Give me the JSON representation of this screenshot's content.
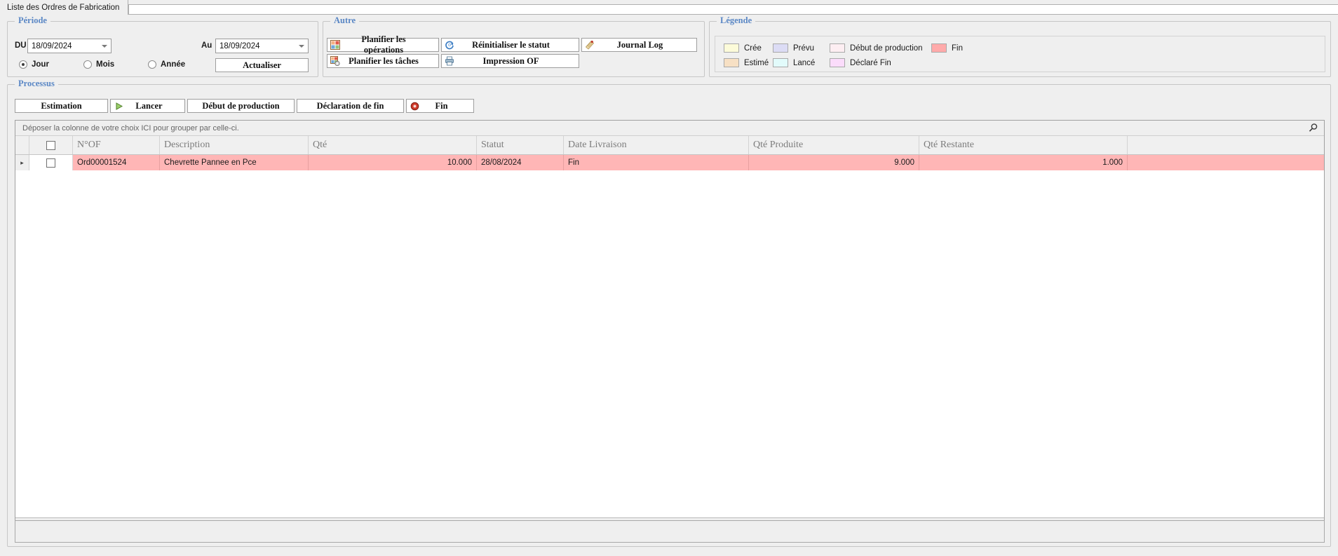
{
  "tab": {
    "label": "Liste des Ordres de Fabrication"
  },
  "periode": {
    "title": "Période",
    "du_label": "DU",
    "du_value": "18/09/2024",
    "au_label": "Au",
    "au_value": "18/09/2024",
    "radios": [
      {
        "label": "Jour",
        "checked": true
      },
      {
        "label": "Mois",
        "checked": false
      },
      {
        "label": "Année",
        "checked": false
      }
    ],
    "refresh_label": "Actualiser"
  },
  "autre": {
    "title": "Autre",
    "buttons": [
      {
        "label": "Planifier les opérations",
        "icon": "grid-color-icon"
      },
      {
        "label": "Planifier les tâches",
        "icon": "grid-gear-icon"
      },
      {
        "label": "Réinitialiser le statut",
        "icon": "refresh-icon"
      },
      {
        "label": "Impression OF",
        "icon": "printer-icon"
      },
      {
        "label": "Journal Log",
        "icon": "notebook-icon"
      }
    ]
  },
  "legende": {
    "title": "Légende",
    "items": [
      {
        "label": "Crée",
        "color": "#fcfbd9"
      },
      {
        "label": "Prévu",
        "color": "#dcdcf5"
      },
      {
        "label": "Début de production",
        "color": "#fdeef2"
      },
      {
        "label": "Fin",
        "color": "#ffaaaa"
      },
      {
        "label": "Estimé",
        "color": "#f7e0c4"
      },
      {
        "label": "Lancé",
        "color": "#e2fbfb"
      },
      {
        "label": "Déclaré Fin",
        "color": "#fbdcfb"
      }
    ]
  },
  "processus": {
    "title": "Processus",
    "buttons": [
      {
        "label": "Estimation",
        "icon": "none"
      },
      {
        "label": "Lancer",
        "icon": "play-green-icon"
      },
      {
        "label": "Début de production",
        "icon": "none"
      },
      {
        "label": "Déclaration de fin",
        "icon": "none"
      },
      {
        "label": "Fin",
        "icon": "stop-red-icon"
      }
    ]
  },
  "grid": {
    "group_hint": "Déposer la colonne de votre choix ICI pour grouper par celle-ci.",
    "search_icon": "search-icon",
    "columns": [
      "N°OF",
      "Description",
      "Qté",
      "Statut",
      "Date Livraison",
      "Qté Produite",
      "Qté Restante"
    ],
    "rows": [
      {
        "row_color": "#ffb6b6",
        "indicator": "▸",
        "selected": false,
        "nof": "Ord00001524",
        "description": "Chevrette Pannee en Pce",
        "qte": "10.000",
        "statut": "28/08/2024",
        "date_livraison": "Fin",
        "qte_produite": "9.000",
        "qte_restante": "1.000"
      }
    ]
  },
  "colors": {
    "accent": "#5a87c5",
    "window": "#efefef",
    "grid_header": "#f0f0f0",
    "row_highlight": "#ffb6b6"
  }
}
